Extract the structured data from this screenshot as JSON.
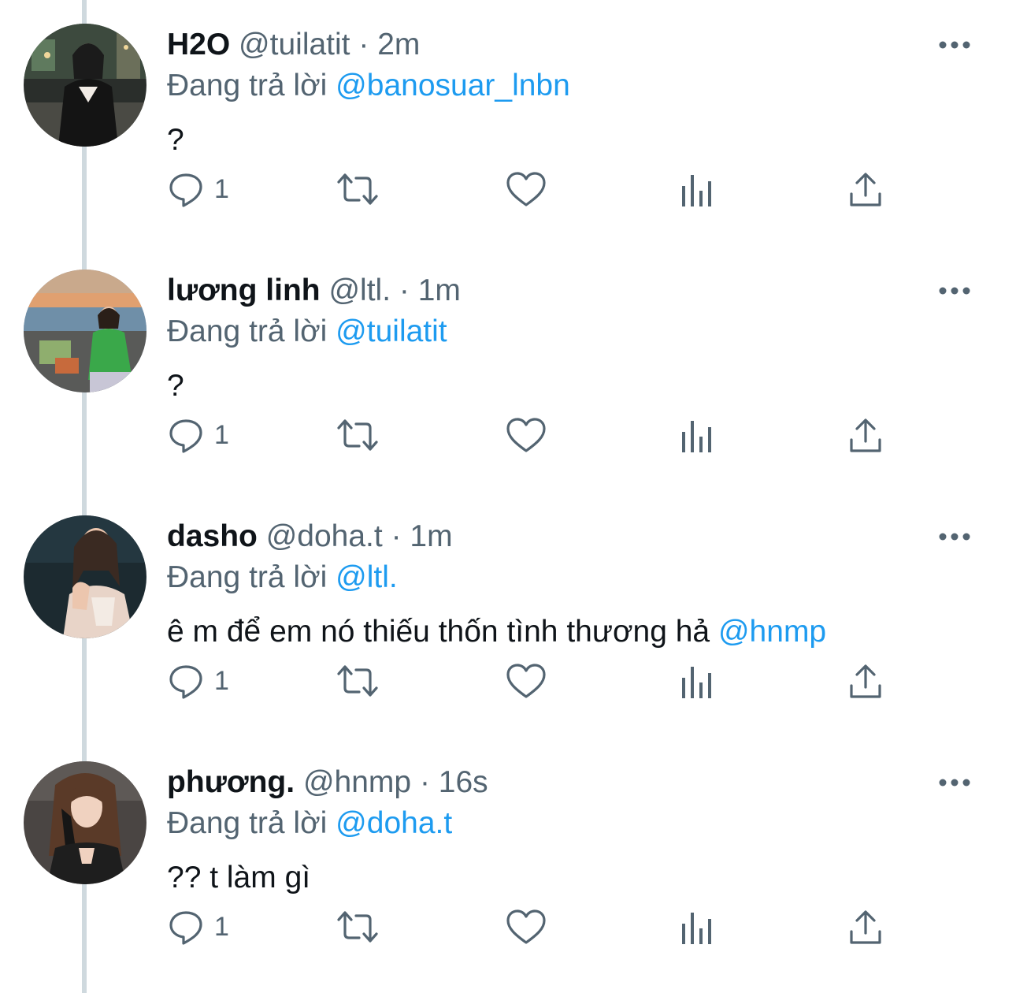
{
  "colors": {
    "text": "#0f1419",
    "secondary": "#536471",
    "link": "#1d9bf0",
    "thread_line": "#cfd9de"
  },
  "replying_prefix": "Đang trả lời",
  "tweets": [
    {
      "display_name": "H2O",
      "handle": "@tuilatit",
      "separator": "·",
      "time": "2m",
      "replying_to": "@banosuar_lnbn",
      "text": "?",
      "text_mention": "",
      "reply_count": "1",
      "avatar_icon": "avatar-photo-icon"
    },
    {
      "display_name": "lương linh",
      "handle": "@ltl.",
      "separator": "·",
      "time": "1m",
      "replying_to": "@tuilatit",
      "text": "?",
      "text_mention": "",
      "reply_count": "1",
      "avatar_icon": "avatar-photo-icon"
    },
    {
      "display_name": "dasho",
      "handle": "@doha.t",
      "separator": "·",
      "time": "1m",
      "replying_to": "@ltl.",
      "text": "ê m để em nó thiếu thốn tình thương hả ",
      "text_mention": "@hnmp",
      "reply_count": "1",
      "avatar_icon": "avatar-photo-icon"
    },
    {
      "display_name": "phương.",
      "handle": "@hnmp",
      "separator": "·",
      "time": "16s",
      "replying_to": "@doha.t",
      "text": "?? t làm gì",
      "text_mention": "",
      "reply_count": "1",
      "avatar_icon": "avatar-photo-icon"
    }
  ],
  "action_icons": [
    "reply-icon",
    "retweet-icon",
    "like-icon",
    "analytics-icon",
    "share-icon"
  ]
}
